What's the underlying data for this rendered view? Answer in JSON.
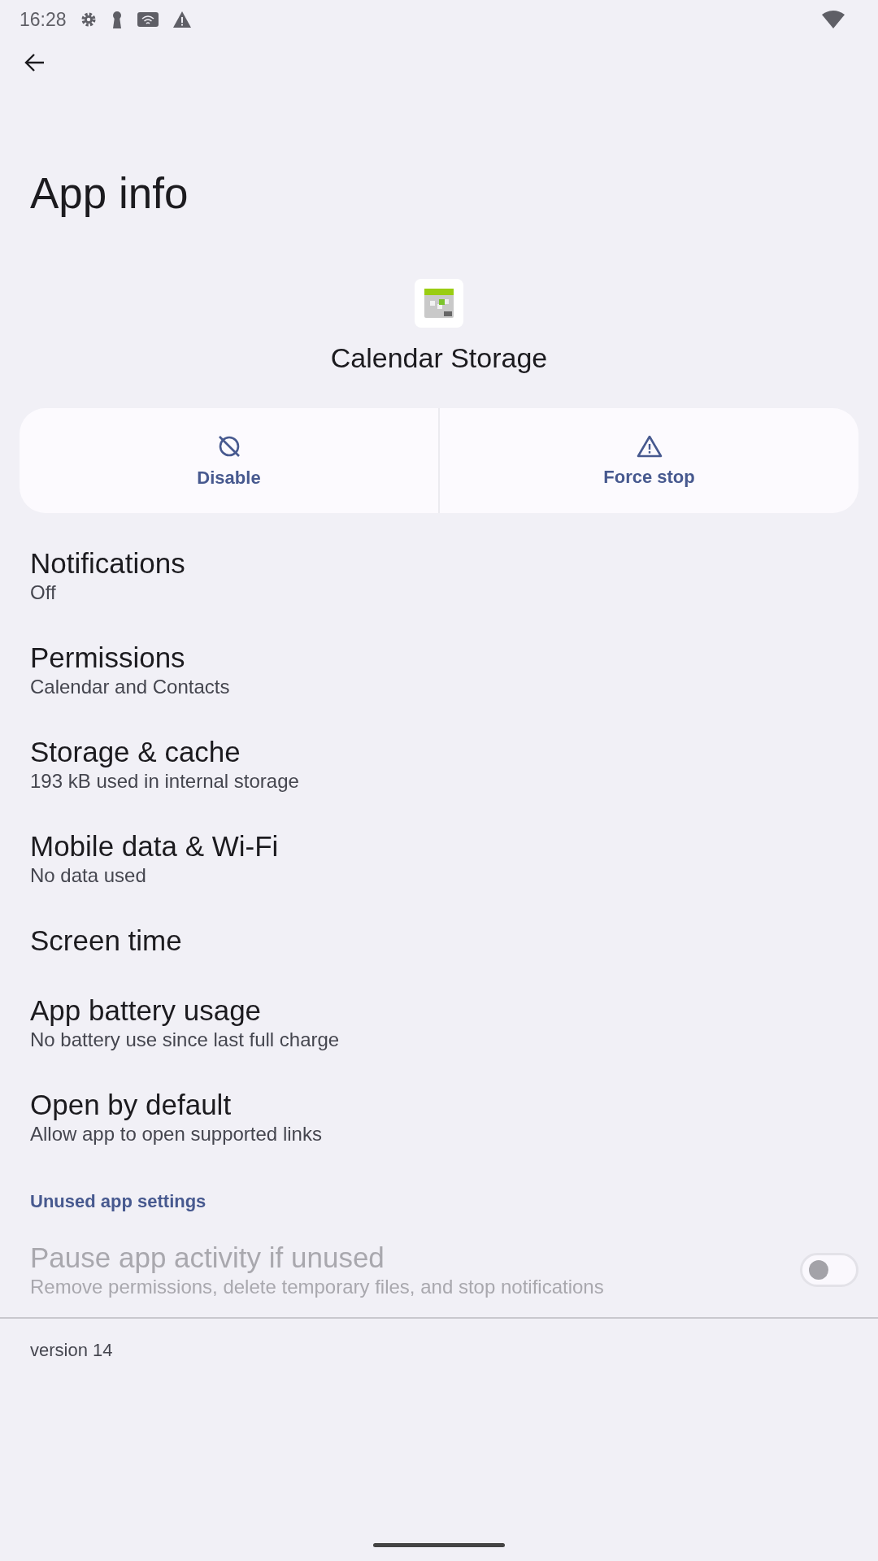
{
  "status_bar": {
    "time": "16:28"
  },
  "title": "App info",
  "app": {
    "name": "Calendar Storage"
  },
  "actions": [
    {
      "label": "Disable",
      "kind": "disable"
    },
    {
      "label": "Force stop",
      "kind": "stop"
    }
  ],
  "items": [
    {
      "title": "Notifications",
      "subtitle": "Off"
    },
    {
      "title": "Permissions",
      "subtitle": "Calendar and Contacts"
    },
    {
      "title": "Storage & cache",
      "subtitle": "193 kB used in internal storage"
    },
    {
      "title": "Mobile data & Wi-Fi",
      "subtitle": "No data used"
    },
    {
      "title": "Screen time"
    },
    {
      "title": "App battery usage",
      "subtitle": "No battery use since last full charge"
    },
    {
      "title": "Open by default",
      "subtitle": "Allow app to open supported links"
    }
  ],
  "section": {
    "header": "Unused app settings",
    "items": [
      {
        "title": "Pause app activity if unused",
        "subtitle": "Remove permissions, delete temporary files, and stop notifications",
        "on": false,
        "disabled": true
      }
    ]
  },
  "version": "version 14"
}
